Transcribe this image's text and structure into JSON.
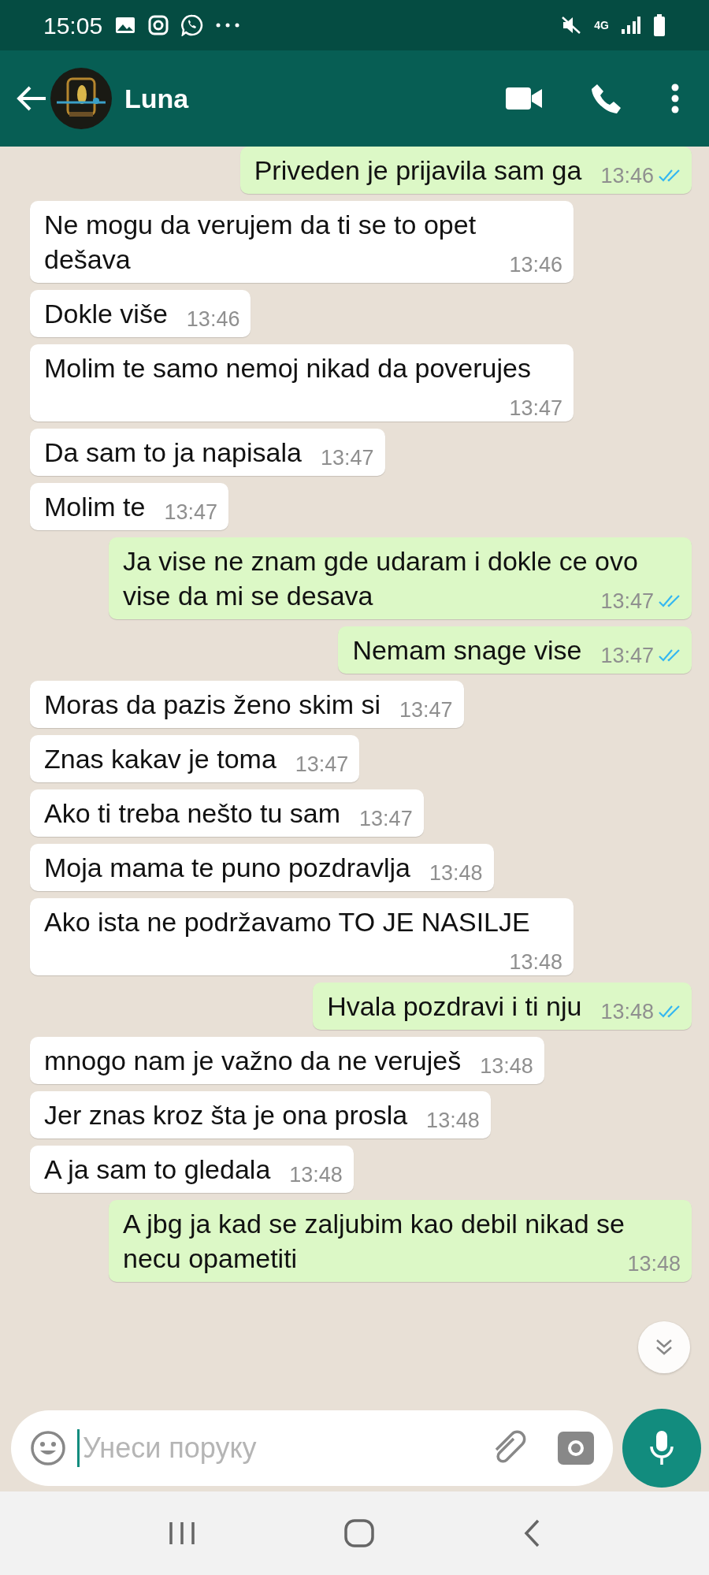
{
  "status_bar": {
    "time": "15:05",
    "network": "4G"
  },
  "header": {
    "contact_name": "Luna"
  },
  "messages": [
    {
      "kind": "outgoing",
      "text": "Priveden je prijavila sam ga",
      "time": "13:46",
      "read": true
    },
    {
      "kind": "incoming",
      "text": "Ne mogu da verujem da ti se to opet dešava",
      "time": "13:46"
    },
    {
      "kind": "incoming",
      "text": "Dokle više",
      "time": "13:46"
    },
    {
      "kind": "incoming",
      "text": "Molim te samo nemoj nikad da poverujes",
      "time": "13:47"
    },
    {
      "kind": "incoming",
      "text": "Da sam to ja napisala",
      "time": "13:47"
    },
    {
      "kind": "incoming",
      "text": "Molim te",
      "time": "13:47"
    },
    {
      "kind": "outgoing",
      "text": "Ja vise ne znam gde udaram i dokle ce ovo vise da mi se desava",
      "time": "13:47",
      "read": true
    },
    {
      "kind": "outgoing",
      "text": "Nemam snage vise",
      "time": "13:47",
      "read": true
    },
    {
      "kind": "incoming",
      "text": "Moras da pazis ženo skim si",
      "time": "13:47"
    },
    {
      "kind": "incoming",
      "text": "Znas kakav je toma",
      "time": "13:47"
    },
    {
      "kind": "incoming",
      "text": "Ako ti treba nešto tu sam",
      "time": "13:47"
    },
    {
      "kind": "incoming",
      "text": "Moja mama te puno pozdravlja",
      "time": "13:48"
    },
    {
      "kind": "incoming",
      "text": "Ako ista ne podržavamo TO JE NASILJE",
      "time": "13:48"
    },
    {
      "kind": "outgoing",
      "text": "Hvala pozdravi i ti nju",
      "time": "13:48",
      "read": true
    },
    {
      "kind": "incoming",
      "text": "mnogo nam je važno da ne veruješ",
      "time": "13:48"
    },
    {
      "kind": "incoming",
      "text": "Jer znas kroz šta je ona prosla",
      "time": "13:48"
    },
    {
      "kind": "incoming",
      "text": "A ja sam to gledala",
      "time": "13:48"
    },
    {
      "kind": "outgoing",
      "text": "A jbg ja kad se zaljubim kao debil nikad se necu opametiti",
      "time": "13:48"
    }
  ],
  "composer": {
    "placeholder": "Унеси поруку"
  }
}
